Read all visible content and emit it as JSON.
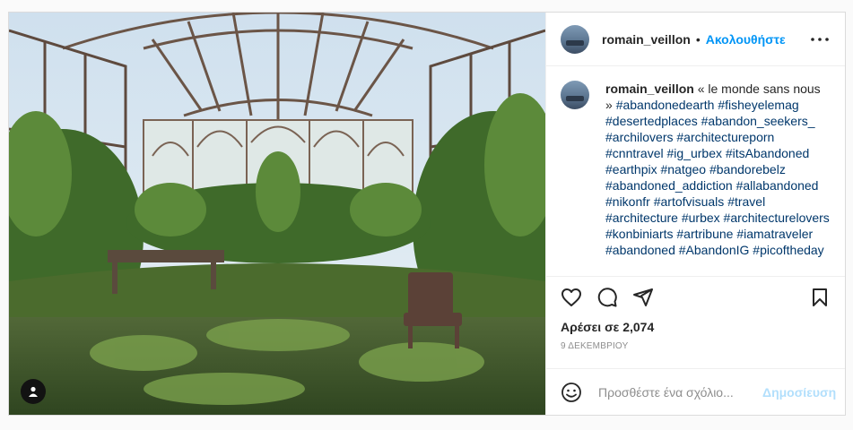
{
  "post": {
    "username": "romain_veillon",
    "separator": "•",
    "follow_label": "Ακολουθήστε",
    "caption_text": "« le monde sans nous »",
    "hashtags": [
      "#abandonedearth",
      "#fisheyelemag",
      "#desertedplaces",
      "#abandon_seekers_",
      "#archilovers",
      "#architectureporn",
      "#cnntravel",
      "#ig_urbex",
      "#itsAbandoned",
      "#earthpix",
      "#natgeo",
      "#bandorebelz",
      "#abandoned_addiction",
      "#allabandoned",
      "#nikonfr",
      "#artofvisuals",
      "#travel",
      "#architecture",
      "#urbex",
      "#architecturelovers",
      "#konbiniarts",
      "#artribune",
      "#iamatraveler",
      "#abandoned",
      "#AbandonIG",
      "#picoftheday"
    ],
    "likes_text": "Αρέσει σε 2,074",
    "date_text": "9 ΔΕΚΕΜΒΡΙΟΥ",
    "comment_placeholder": "Προσθέστε ένα σχόλιο...",
    "post_label": "Δημοσίευση"
  },
  "icons": {
    "more": "more-options-icon",
    "like": "heart-icon",
    "comment": "comment-icon",
    "share": "paper-plane-icon",
    "save": "bookmark-icon",
    "emoji": "emoji-icon",
    "tag": "user-tag-icon"
  },
  "colors": {
    "accent": "#0095f6",
    "hashtag": "#00376b",
    "post_disabled": "#b2dffc",
    "muted": "#8e8e8e"
  }
}
